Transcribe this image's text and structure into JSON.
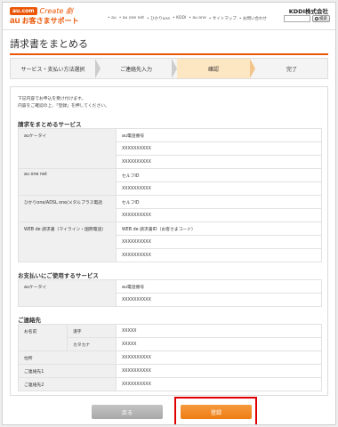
{
  "header": {
    "au_badge": "au.com",
    "create_text": "Create 劇",
    "au_mark": "au",
    "support_title": "お客さまサポート",
    "nav": [
      "• au",
      "• au one net",
      "• ひかりone",
      "• KDDI",
      "• au one",
      "• サイトマップ",
      "• お問い合わせ"
    ],
    "company": "KDDI株式会社",
    "search_label": "検索"
  },
  "page_title": "請求書をまとめる",
  "steps": [
    {
      "label": "サービス・支払い方法選択",
      "active": false
    },
    {
      "label": "ご連絡先入力",
      "active": false
    },
    {
      "label": "確認",
      "active": true
    },
    {
      "label": "完了",
      "active": false
    }
  ],
  "intro": {
    "line1": "下記内容でお申込を受け付けます。",
    "line2": "内容をご確認の上、「登録」を押してください。"
  },
  "sections": {
    "services": {
      "title": "請求をまとめるサービス",
      "rows": [
        {
          "label": "auケータイ",
          "values": [
            "au電話番号",
            "XXXXXXXXXX",
            "XXXXXXXXXX"
          ]
        },
        {
          "label": "au one net",
          "values": [
            "セルフID",
            "XXXXXXXXXX"
          ]
        },
        {
          "label": "ひかりone/ADSL one/メタルプラス電話",
          "values": [
            "セルフID",
            "XXXXXXXXXX"
          ]
        },
        {
          "label": "WEB de 請求書（マイライン・国際電話）",
          "values": [
            "WEB de 請求書ID（お客さまコード）",
            "XXXXXXXXXX",
            "XXXXXXXXXX"
          ]
        }
      ]
    },
    "payment": {
      "title": "お支払いにご使用するサービス",
      "rows": [
        {
          "label": "auケータイ",
          "values": [
            "au電話番号",
            "XXXXXXXXXX"
          ]
        }
      ]
    },
    "contact": {
      "title": "ご連絡先",
      "name_label": "お名前",
      "kanji_label": "漢字",
      "kanji_value": "XXXXX",
      "kana_label": "カタカナ",
      "kana_value": "XXXXX",
      "address_label": "住所",
      "address_value": "XXXXXXXXXX",
      "contact1_label": "ご連絡先1",
      "contact1_value": "XXXXXXXXXX",
      "contact2_label": "ご連絡先2",
      "contact2_value": "XXXXXXXXXX"
    }
  },
  "buttons": {
    "back": "戻る",
    "submit": "登録"
  },
  "colors": {
    "brand": "#eb5505",
    "active_step": "#fde6c2",
    "highlight": "#e00000"
  }
}
